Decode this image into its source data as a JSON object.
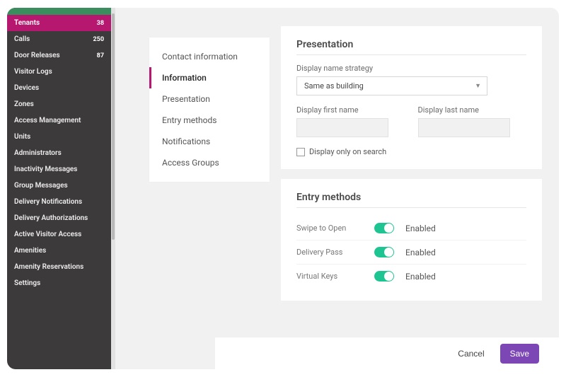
{
  "sidebar": {
    "items": [
      {
        "label": "Tenants",
        "badge": "38",
        "active": true
      },
      {
        "label": "Calls",
        "badge": "250"
      },
      {
        "label": "Door Releases",
        "badge": "87"
      },
      {
        "label": "Visitor Logs"
      },
      {
        "label": "Devices"
      },
      {
        "label": "Zones"
      },
      {
        "label": "Access Management"
      },
      {
        "label": "Units"
      },
      {
        "label": "Administrators"
      },
      {
        "label": "Inactivity Messages"
      },
      {
        "label": "Group Messages"
      },
      {
        "label": "Delivery Notifications"
      },
      {
        "label": "Delivery Authorizations"
      },
      {
        "label": "Active Visitor Access"
      },
      {
        "label": "Amenities"
      },
      {
        "label": "Amenity Reservations"
      },
      {
        "label": "Settings"
      }
    ]
  },
  "subnav": {
    "items": [
      {
        "label": "Contact information"
      },
      {
        "label": "Information",
        "active": true
      },
      {
        "label": "Presentation"
      },
      {
        "label": "Entry methods"
      },
      {
        "label": "Notifications"
      },
      {
        "label": "Access Groups"
      }
    ]
  },
  "presentation": {
    "title": "Presentation",
    "strategy_label": "Display name strategy",
    "strategy_value": "Same as building",
    "first_label": "Display first name",
    "last_label": "Display last name",
    "checkbox_label": "Display only on search"
  },
  "entry_methods": {
    "title": "Entry methods",
    "methods": [
      {
        "name": "Swipe to Open",
        "status": "Enabled"
      },
      {
        "name": "Delivery Pass",
        "status": "Enabled"
      },
      {
        "name": "Virtual Keys",
        "status": "Enabled"
      }
    ]
  },
  "footer": {
    "cancel": "Cancel",
    "save": "Save"
  }
}
